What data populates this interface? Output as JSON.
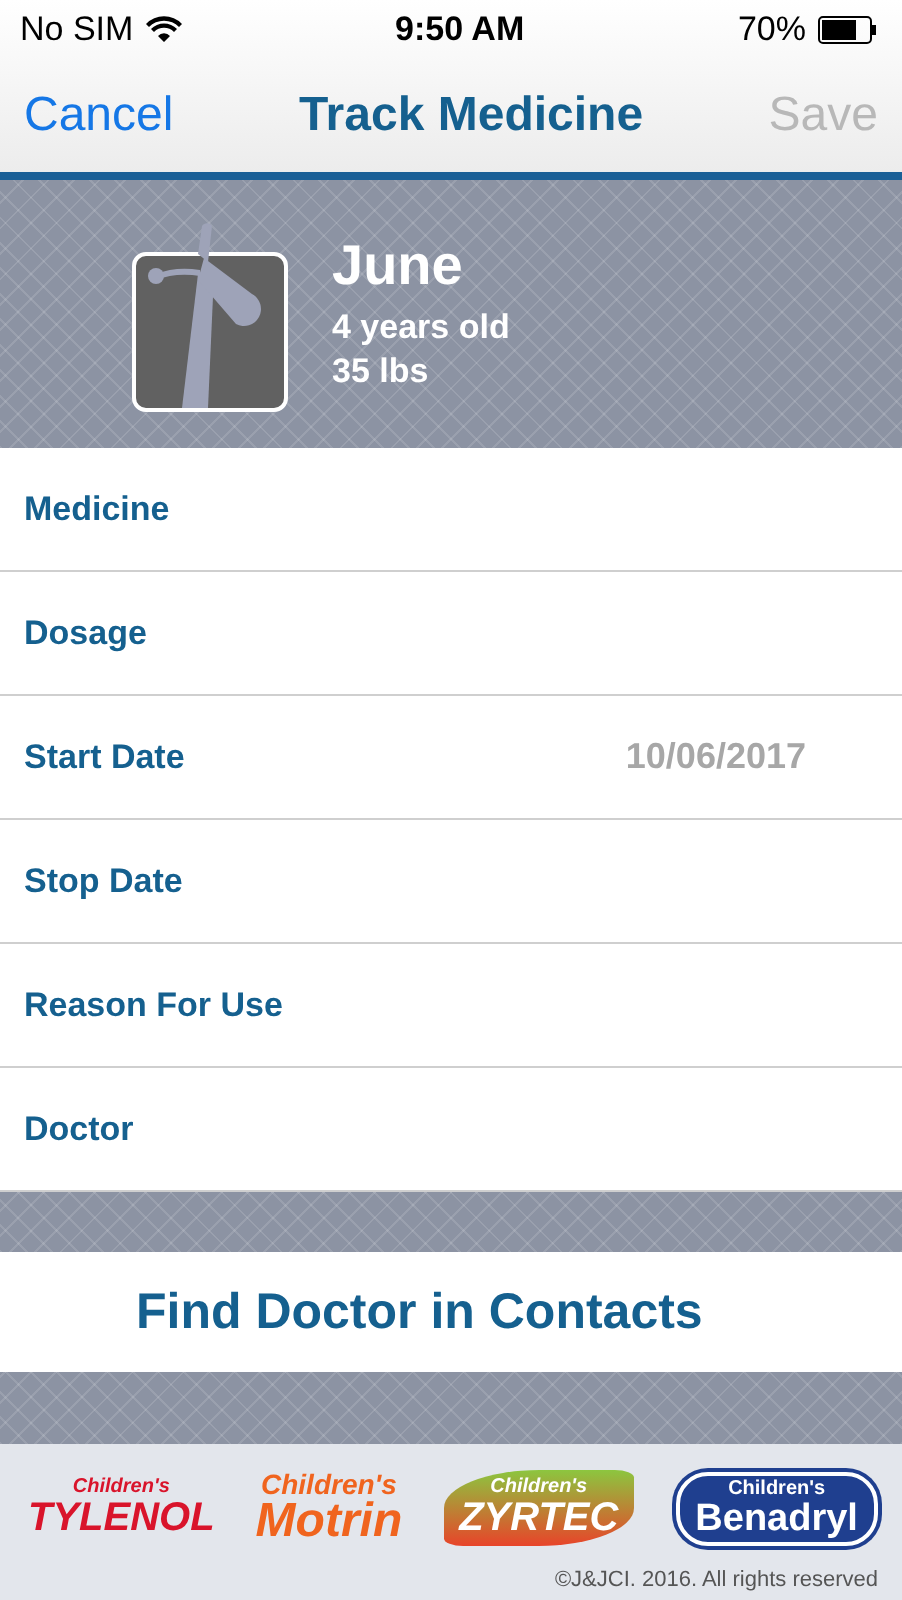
{
  "status_bar": {
    "carrier": "No SIM",
    "time": "9:50 AM",
    "battery": "70%"
  },
  "nav": {
    "cancel": "Cancel",
    "title": "Track Medicine",
    "save": {
      "label": "Save",
      "disabled": true
    }
  },
  "profile": {
    "name": "June",
    "age": "4 years old",
    "weight": "35 lbs"
  },
  "fields": [
    {
      "label": "Medicine"
    },
    {
      "label": "Dosage"
    },
    {
      "label": "Start Date",
      "value": "10/06/2017"
    },
    {
      "label": "Stop Date"
    },
    {
      "label": "Reason For Use"
    },
    {
      "label": "Doctor"
    }
  ],
  "find_button": "Find Doctor in Contacts",
  "footer": {
    "logos": [
      {
        "kind": "tylenol",
        "top": "Children's",
        "brand": "TYLENOL"
      },
      {
        "kind": "motrin",
        "top": "Children's",
        "brand": "Motrin"
      },
      {
        "kind": "zyrtec",
        "top": "Children's",
        "brand": "ZYRTEC"
      },
      {
        "kind": "benadryl",
        "top": "Children's",
        "brand": "Benadryl"
      }
    ],
    "copyright": "©J&JCI. 2016. All rights reserved"
  }
}
